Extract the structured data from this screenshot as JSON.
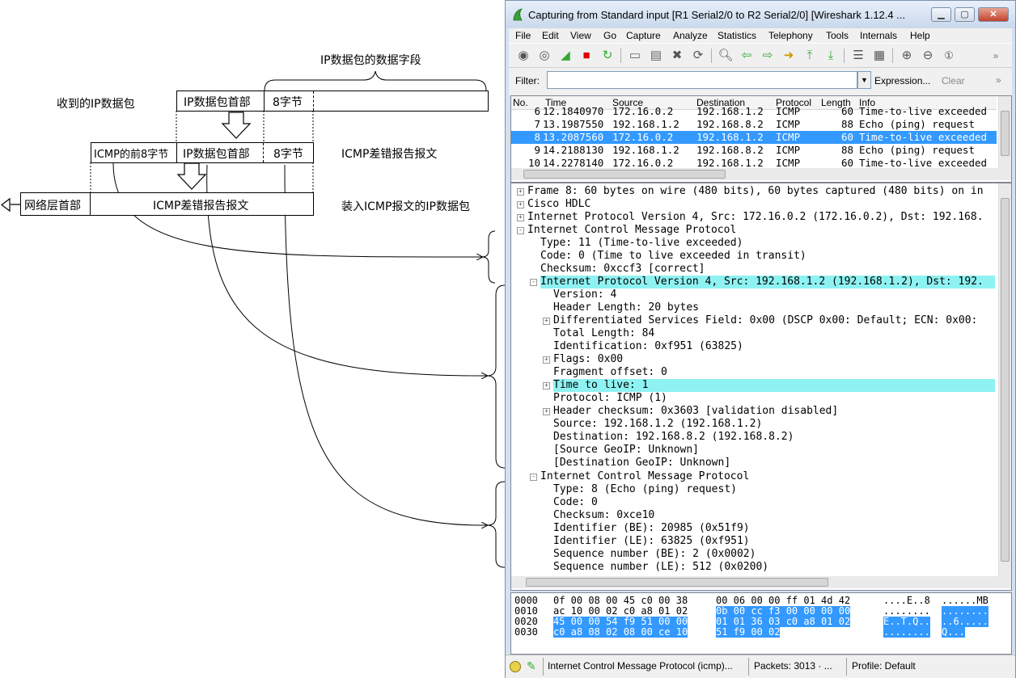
{
  "diagram": {
    "top_brace_label": "IP数据包的数据字段",
    "row1_label": "收到的IP数据包",
    "row1_cells": [
      "IP数据包首部",
      "8字节"
    ],
    "row2_cells": [
      "ICMP的前8字节",
      "IP数据包首部",
      "8字节"
    ],
    "row2_label": "ICMP差错报告报文",
    "row3_left": "网络层首部",
    "row3_cell": "ICMP差错报告报文",
    "row3_label": "装入ICMP报文的IP数据包"
  },
  "window": {
    "title": "Capturing from Standard input    [R1 Serial2/0 to R2 Serial2/0]   [Wireshark 1.12.4 ...",
    "menu": [
      "File",
      "Edit",
      "View",
      "Go",
      "Capture",
      "Analyze",
      "Statistics",
      "Telephony",
      "Tools",
      "Internals",
      "Help"
    ],
    "filter": {
      "label": "Filter:",
      "value": "",
      "expression": "Expression...",
      "clear": "Clear"
    }
  },
  "packet_list": {
    "columns": [
      "No.",
      "Time",
      "Source",
      "Destination",
      "Protocol",
      "Length",
      "Info"
    ],
    "rows": [
      {
        "no": "6",
        "time": "12.1840970",
        "src": "172.16.0.2",
        "dst": "192.168.1.2",
        "proto": "ICMP",
        "len": "60",
        "info": "Time-to-live exceeded"
      },
      {
        "no": "7",
        "time": "13.1987550",
        "src": "192.168.1.2",
        "dst": "192.168.8.2",
        "proto": "ICMP",
        "len": "88",
        "info": "Echo (ping) request"
      },
      {
        "no": "8",
        "time": "13.2087560",
        "src": "172.16.0.2",
        "dst": "192.168.1.2",
        "proto": "ICMP",
        "len": "60",
        "info": "Time-to-live exceeded"
      },
      {
        "no": "9",
        "time": "14.2188130",
        "src": "192.168.1.2",
        "dst": "192.168.8.2",
        "proto": "ICMP",
        "len": "88",
        "info": "Echo (ping) request"
      },
      {
        "no": "10",
        "time": "14.2278140",
        "src": "172.16.0.2",
        "dst": "192.168.1.2",
        "proto": "ICMP",
        "len": "60",
        "info": "Time-to-live exceeded"
      }
    ]
  },
  "details": [
    {
      "text": "Frame 8: 60 bytes on wire (480 bits), 60 bytes captured (480 bits) on in",
      "exp": "+"
    },
    {
      "text": "Cisco HDLC",
      "exp": "+"
    },
    {
      "text": "Internet Protocol Version 4, Src: 172.16.0.2 (172.16.0.2), Dst: 192.168.",
      "exp": "+"
    },
    {
      "text": "Internet Control Message Protocol",
      "exp": "-"
    },
    {
      "text": "Type: 11 (Time-to-live exceeded)",
      "exp": ""
    },
    {
      "text": "Code: 0 (Time to live exceeded in transit)",
      "exp": ""
    },
    {
      "text": "Checksum: 0xccf3 [correct]",
      "exp": ""
    },
    {
      "text": "Internet Protocol Version 4, Src: 192.168.1.2 (192.168.1.2), Dst: 192.",
      "exp": "-"
    },
    {
      "text": "Version: 4",
      "exp": ""
    },
    {
      "text": "Header Length: 20 bytes",
      "exp": ""
    },
    {
      "text": "Differentiated Services Field: 0x00 (DSCP 0x00: Default; ECN: 0x00:",
      "exp": "+"
    },
    {
      "text": "Total Length: 84",
      "exp": ""
    },
    {
      "text": "Identification: 0xf951 (63825)",
      "exp": ""
    },
    {
      "text": "Flags: 0x00",
      "exp": "+"
    },
    {
      "text": "Fragment offset: 0",
      "exp": ""
    },
    {
      "text": "Time to live: 1",
      "exp": "+"
    },
    {
      "text": "Protocol: ICMP (1)",
      "exp": ""
    },
    {
      "text": "Header checksum: 0x3603 [validation disabled]",
      "exp": "+"
    },
    {
      "text": "Source: 192.168.1.2 (192.168.1.2)",
      "exp": ""
    },
    {
      "text": "Destination: 192.168.8.2 (192.168.8.2)",
      "exp": ""
    },
    {
      "text": "[Source GeoIP: Unknown]",
      "exp": ""
    },
    {
      "text": "[Destination GeoIP: Unknown]",
      "exp": ""
    },
    {
      "text": "Internet Control Message Protocol",
      "exp": "-"
    },
    {
      "text": "Type: 8 (Echo (ping) request)",
      "exp": ""
    },
    {
      "text": "Code: 0",
      "exp": ""
    },
    {
      "text": "Checksum: 0xce10",
      "exp": ""
    },
    {
      "text": "Identifier (BE): 20985 (0x51f9)",
      "exp": ""
    },
    {
      "text": "Identifier (LE): 63825 (0xf951)",
      "exp": ""
    },
    {
      "text": "Sequence number (BE): 2 (0x0002)",
      "exp": ""
    },
    {
      "text": "Sequence number (LE): 512 (0x0200)",
      "exp": ""
    }
  ],
  "bytes": [
    {
      "off": "0000",
      "hexA": "0f 00 08 00 45 c0 00 38",
      "hexB": "00 06 00 00 ff 01 4d 42",
      "ascA": "....E..8",
      "ascB": "......MB"
    },
    {
      "off": "0010",
      "hexA": "ac 10 00 02 c0 a8 01 02",
      "hexB": "0b 00 cc f3 00 00 00 00",
      "ascA": "........",
      "ascB": "........"
    },
    {
      "off": "0020",
      "hexA": "45 00 00 54 f9 51 00 00",
      "hexB": "01 01 36 03 c0 a8 01 02",
      "ascA": "E..T.Q..",
      "ascB": "..6....."
    },
    {
      "off": "0030",
      "hexA": "c0 a8 08 02 08 00 ce 10",
      "hexB": "51 f9 00 02",
      "ascA": "........",
      "ascB": "Q..."
    }
  ],
  "status": {
    "info": "Internet Control Message Protocol (icmp)...",
    "packets": "Packets: 3013 · ...",
    "profile": "Profile: Default"
  },
  "colors": {
    "selection": "#3399ff",
    "highlight": "#8ff2f2",
    "window_frame": "#d4e1f1"
  }
}
